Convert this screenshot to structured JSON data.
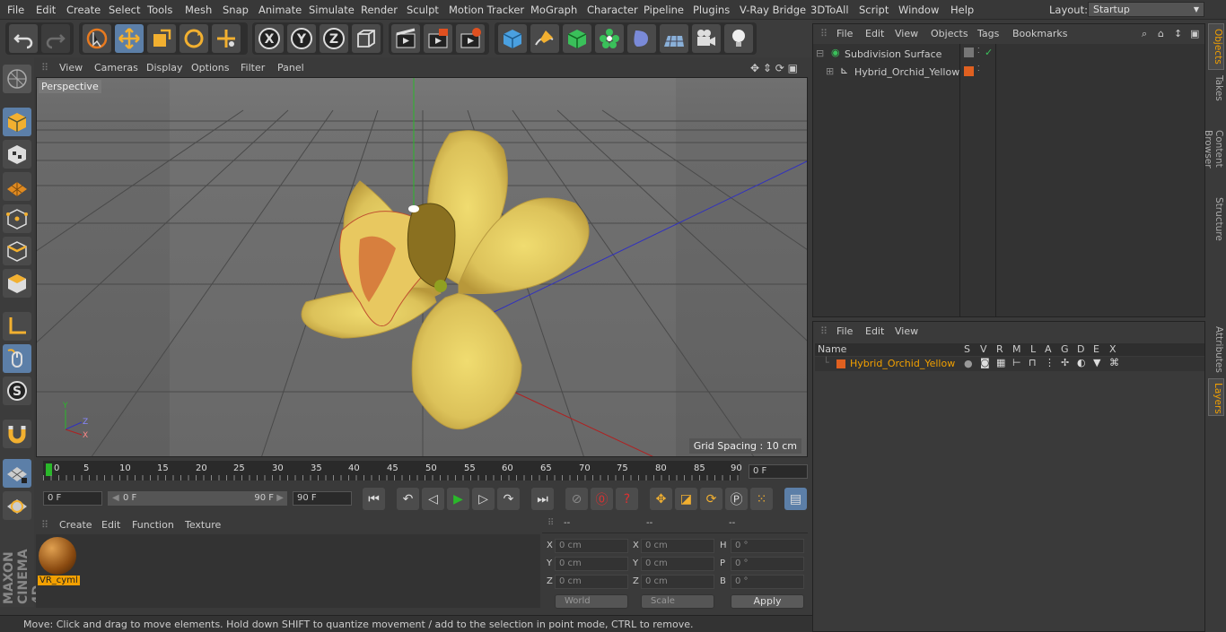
{
  "menubar": {
    "items": [
      "File",
      "Edit",
      "Create",
      "Select",
      "Tools",
      "Mesh",
      "Snap",
      "Animate",
      "Simulate",
      "Render",
      "Sculpt",
      "Motion Tracker",
      "MoGraph",
      "Character",
      "Pipeline",
      "Plugins",
      "V-Ray Bridge",
      "3DToAll",
      "Script",
      "Window",
      "Help"
    ],
    "layout_label": "Layout:",
    "layout_value": "Startup"
  },
  "viewport": {
    "menu": [
      "View",
      "Cameras",
      "Display",
      "Options",
      "Filter",
      "Panel"
    ],
    "label": "Perspective",
    "grid_spacing": "Grid Spacing : 10 cm"
  },
  "timeline": {
    "ticks": [
      "0",
      "5",
      "10",
      "15",
      "20",
      "25",
      "30",
      "35",
      "40",
      "45",
      "50",
      "55",
      "60",
      "65",
      "70",
      "75",
      "80",
      "85",
      "90"
    ],
    "current_frame": "0 F"
  },
  "transport": {
    "start_field": "0 F",
    "range_start": "0 F",
    "range_end": "90 F",
    "end_field": "90 F"
  },
  "material": {
    "menu": [
      "Create",
      "Edit",
      "Function",
      "Texture"
    ],
    "name": "VR_cyml"
  },
  "coordinates": {
    "headers": [
      "--",
      "--",
      "--"
    ],
    "rows": [
      {
        "l1": "X",
        "v1": "0 cm",
        "l2": "X",
        "v2": "0 cm",
        "l3": "H",
        "v3": "0 °"
      },
      {
        "l1": "Y",
        "v1": "0 cm",
        "l2": "Y",
        "v2": "0 cm",
        "l3": "P",
        "v3": "0 °"
      },
      {
        "l1": "Z",
        "v1": "0 cm",
        "l2": "Z",
        "v2": "0 cm",
        "l3": "B",
        "v3": "0 °"
      }
    ],
    "mode": "World",
    "scale": "Scale",
    "apply": "Apply"
  },
  "status": "Move: Click and drag to move elements. Hold down SHIFT to quantize movement / add to the selection in point mode, CTRL to remove.",
  "objects": {
    "menu": [
      "File",
      "Edit",
      "View",
      "Objects",
      "Tags",
      "Bookmarks"
    ],
    "items": [
      "Subdivision Surface",
      "Hybrid_Orchid_Yellow"
    ]
  },
  "layers": {
    "menu": [
      "File",
      "Edit",
      "View"
    ],
    "columns": [
      "Name",
      "S",
      "V",
      "R",
      "M",
      "L",
      "A",
      "G",
      "D",
      "E",
      "X"
    ],
    "row_name": "Hybrid_Orchid_Yellow"
  },
  "right_tabs": [
    "Objects",
    "Takes",
    "Content Browser",
    "Structure",
    "Attributes",
    "Layers"
  ],
  "brand": "MAXON CINEMA 4D",
  "colors": {
    "accent": "#f2a000",
    "selected_tool": "#5c7fa8",
    "layer_color": "#e06020"
  }
}
